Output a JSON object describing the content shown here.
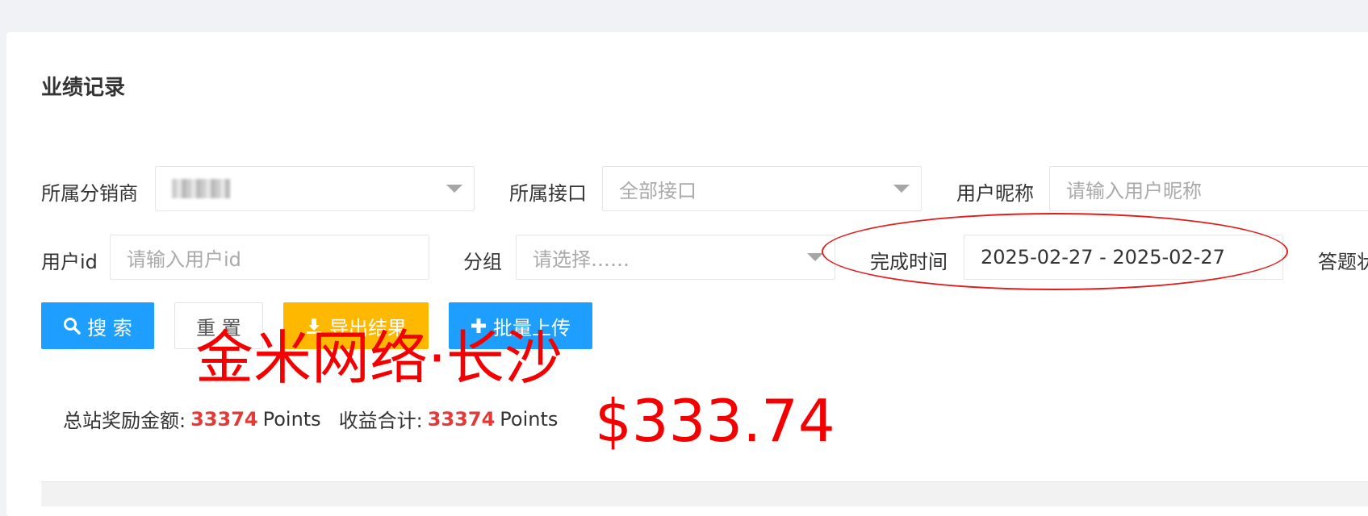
{
  "page": {
    "title": "业绩记录"
  },
  "filters": {
    "distributor": {
      "label": "所属分销商",
      "value": ""
    },
    "interface": {
      "label": "所属接口",
      "value": "全部接口"
    },
    "nickname": {
      "label": "用户昵称",
      "placeholder": "请输入用户昵称"
    },
    "user_id": {
      "label": "用户id",
      "placeholder": "请输入用户id"
    },
    "group": {
      "label": "分组",
      "placeholder": "请选择……"
    },
    "finish_time": {
      "label": "完成时间",
      "value": "2025-02-27 - 2025-02-27"
    },
    "answer_status": {
      "label": "答题状"
    }
  },
  "buttons": {
    "search": "搜 索",
    "reset": "重 置",
    "export": "导出结果",
    "batch_upload": "批量上传"
  },
  "stats": {
    "total_reward_label": "总站奖励金额:",
    "total_reward_value": "33374",
    "unit": "Points",
    "income_label": "收益合计:",
    "income_value": "33374"
  },
  "annotations": {
    "watermark": "金米网络·长沙",
    "amount": "$333.74"
  },
  "colors": {
    "primary": "#1e9fff",
    "warning": "#ffb800",
    "highlight": "#e53935",
    "annotation": "#f50000"
  }
}
